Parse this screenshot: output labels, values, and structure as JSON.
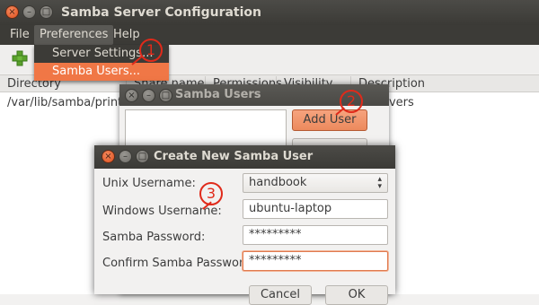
{
  "main_window": {
    "title": "Samba Server Configuration",
    "menubar": {
      "file": "File",
      "preferences": "Preferences",
      "help": "Help"
    },
    "preferences_menu": {
      "server_settings": "Server Settings...",
      "samba_users": "Samba Users..."
    },
    "list": {
      "columns": [
        "Directory",
        "Share name",
        "Permissions",
        "Visibility",
        "Description"
      ],
      "rows": [
        {
          "directory": "/var/lib/samba/printers",
          "description": "Drivers"
        }
      ]
    }
  },
  "users_dialog": {
    "title": "Samba Users",
    "add_user_label": "Add User"
  },
  "create_dialog": {
    "title": "Create New Samba User",
    "unix_username_label": "Unix Username:",
    "unix_username_value": "handbook",
    "windows_username_label": "Windows Username:",
    "windows_username_value": "ubuntu-laptop",
    "samba_password_label": "Samba Password:",
    "samba_password_value": "*********",
    "confirm_password_label": "Confirm Samba Password:",
    "confirm_password_value": "*********",
    "cancel_label": "Cancel",
    "ok_label": "OK"
  },
  "callouts": {
    "one": "1",
    "two": "2",
    "three": "3"
  },
  "colors": {
    "accent": "#f07746",
    "callout": "#e02a1a",
    "titlebar": "#3c3b37"
  },
  "icons": {
    "add": "add-share-icon",
    "close": "close-icon",
    "minimize": "minimize-icon",
    "maximize": "maximize-icon"
  }
}
